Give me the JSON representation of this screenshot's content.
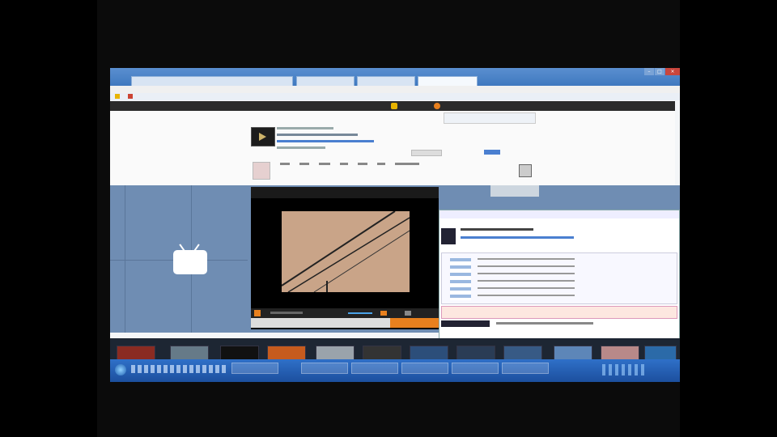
{
  "browser": {
    "tabs": [
      "",
      "",
      "",
      ""
    ],
    "menu": [],
    "favorites": []
  },
  "site": {
    "header_text": "",
    "search_button": "",
    "nav_tabs": []
  },
  "player": {
    "title": "",
    "brand": ""
  },
  "comments": {
    "rows": []
  },
  "taskbar": {
    "items": [
      "",
      "",
      "",
      "",
      "",
      ""
    ],
    "clock": ""
  },
  "colors": {
    "titlebar": "#3f78bf",
    "taskbar": "#1c4f9e",
    "panel_bg": "#6f8db3",
    "accent_orange": "#e8801e"
  },
  "icons": [
    "tv-icon",
    "play-icon",
    "close-icon",
    "search-icon",
    "start-orb-icon"
  ]
}
